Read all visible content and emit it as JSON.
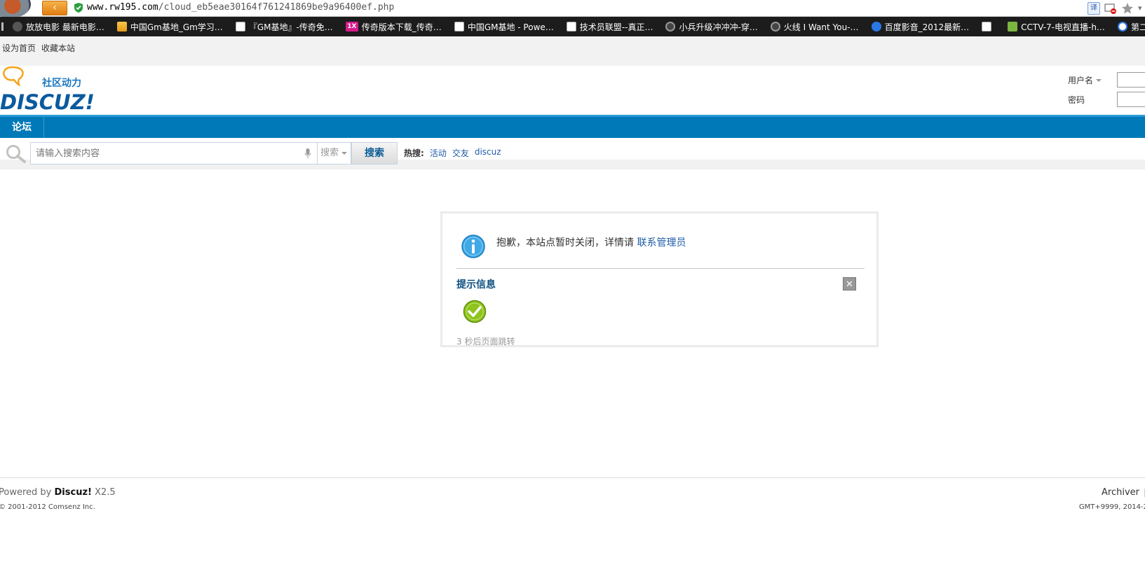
{
  "browser": {
    "url_host": "www.rw195.com",
    "url_path": "/cloud_eb5eae30164f761241869be9a96400ef.php",
    "bookmarks": [
      {
        "label": "放放电影 最新电影…",
        "icon": "film-icon"
      },
      {
        "label": "中国Gm基地_Gm学习…",
        "icon": "sun-icon"
      },
      {
        "label": "『GM基地』-传奇免…",
        "icon": "doc-icon"
      },
      {
        "label": "传奇版本下载_传奇…",
        "icon": "onex-icon"
      },
      {
        "label": "中国GM基地 - Powe…",
        "icon": "doc-icon"
      },
      {
        "label": "技术员联盟--真正…",
        "icon": "doc-icon"
      },
      {
        "label": "小兵升级冲冲冲-穿…",
        "icon": "face-icon"
      },
      {
        "label": "火线 I Want You-…",
        "icon": "face-icon"
      },
      {
        "label": "百度影音_2012最新…",
        "icon": "play-icon"
      },
      {
        "label": "",
        "icon": "doc-icon"
      },
      {
        "label": "CCTV-7-电视直播-h…",
        "icon": "tv-icon"
      },
      {
        "label": "第二集",
        "icon": "play2-icon"
      }
    ],
    "onex_text": "1X",
    "translate_label": "译"
  },
  "topbar": {
    "set_home": "设为首页",
    "bookmark_site": "收藏本站"
  },
  "header": {
    "logo_tagline": "社区动力",
    "logo_text": "DISCUZ!",
    "username_label": "用户名",
    "password_label": "密码"
  },
  "nav": {
    "forum": "论坛"
  },
  "search": {
    "placeholder": "请输入搜索内容",
    "type_label": "搜索",
    "button_label": "搜索",
    "hot_label": "热搜:",
    "hot_links": [
      "活动",
      "交友",
      "discuz"
    ]
  },
  "message": {
    "text": "抱歉，本站点暂时关闭，详情请",
    "link": "联系管理员",
    "title": "提示信息",
    "redirect": "3 秒后页面跳转"
  },
  "footer": {
    "powered_prefix": "Powered by",
    "powered_brand": "Discuz!",
    "version": "X2.5",
    "copyright": "© 2001-2012 Comsenz Inc.",
    "archiver": "Archiver",
    "gmt": "GMT+9999, 2014-2"
  },
  "colors": {
    "nav_blue": "#0079b8",
    "link_blue": "#1f5da8",
    "logo_orange": "#f4a316"
  }
}
